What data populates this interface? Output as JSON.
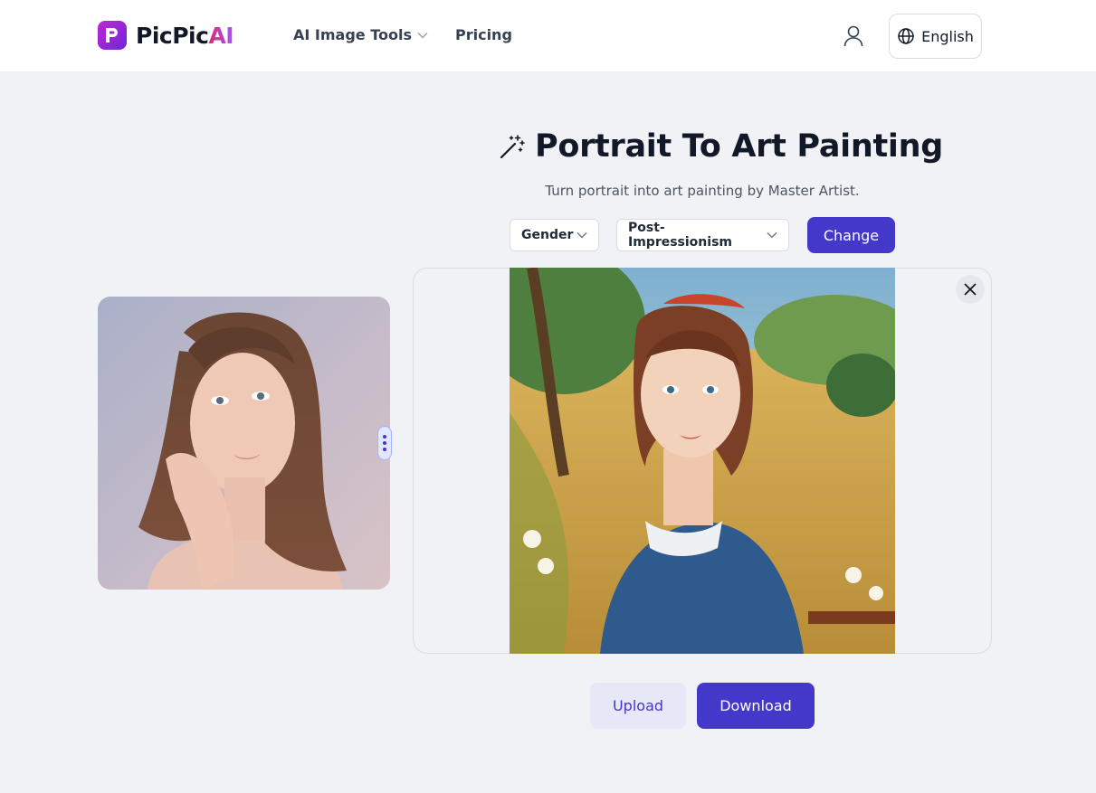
{
  "header": {
    "logo_text_main": "PicPic",
    "logo_text_accent": "AI",
    "nav": [
      {
        "label": "AI Image Tools",
        "has_dropdown": true
      },
      {
        "label": "Pricing",
        "has_dropdown": false
      }
    ],
    "language_label": "English",
    "icons": {
      "user": "user-icon",
      "language": "globe-icon"
    }
  },
  "tool": {
    "title": "Portrait To Art Painting",
    "title_icon": "magic-wand-icon",
    "subtitle": "Turn portrait into art painting by Master Artist.",
    "gender_select": "Gender",
    "style_select": "Post-Impressionism",
    "change_label": "Change"
  },
  "actions": {
    "upload_label": "Upload",
    "download_label": "Download"
  },
  "colors": {
    "primary": "#4338ca",
    "page_bg": "#f1f2f6",
    "upload_bg": "#e6e7f7"
  }
}
